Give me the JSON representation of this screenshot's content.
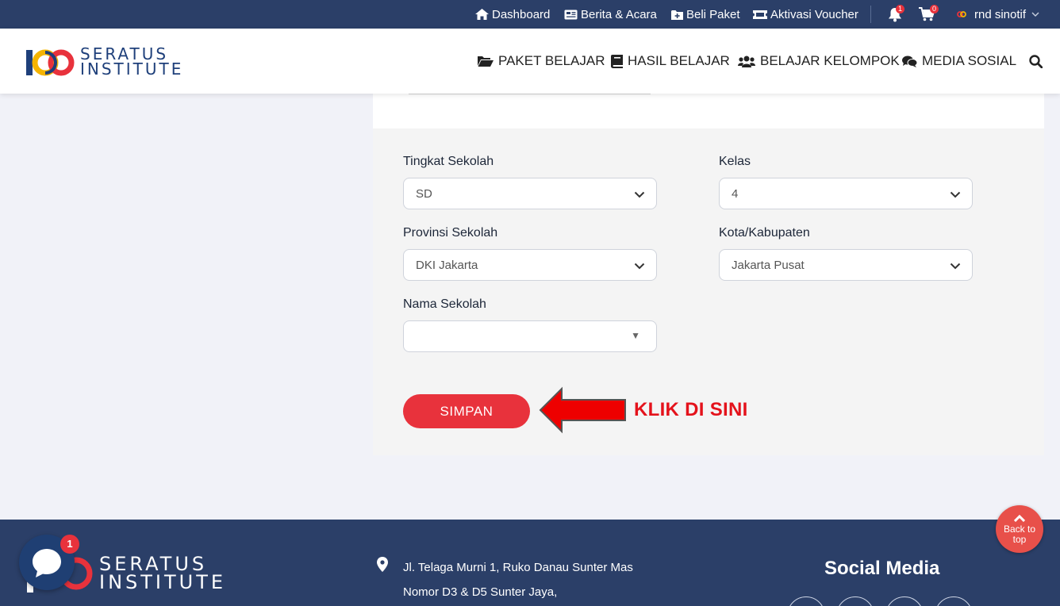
{
  "topbar": {
    "dashboard": "Dashboard",
    "berita": "Berita & Acara",
    "beli_paket": "Beli Paket",
    "aktivasi": "Aktivasi Voucher",
    "notif_count": "1",
    "cart_count": "0",
    "user_name": "rnd sinotif"
  },
  "header": {
    "logo_line1": "SERATUS",
    "logo_line2": "INSTITUTE",
    "nav": {
      "paket": "PAKET BELAJAR",
      "hasil": "HASIL BELAJAR",
      "kelompok": "BELAJAR KELOMPOK",
      "media": "MEDIA SOSIAL"
    }
  },
  "form": {
    "tingkat_label": "Tingkat Sekolah",
    "tingkat_value": "SD",
    "kelas_label": "Kelas",
    "kelas_value": "4",
    "provinsi_label": "Provinsi Sekolah",
    "provinsi_value": "DKI Jakarta",
    "kota_label": "Kota/Kabupaten",
    "kota_value": "Jakarta Pusat",
    "nama_label": "Nama Sekolah",
    "nama_value": "",
    "simpan": "SIMPAN",
    "annotation": "KLIK DI SINI"
  },
  "footer": {
    "logo_line1": "SERATUS",
    "logo_line2": "INSTITUTE",
    "address_line1": "Jl. Telaga Murni 1, Ruko Danau Sunter Mas",
    "address_line2": "Nomor D3 & D5 Sunter Jaya,",
    "social_title": "Social Media",
    "chat_badge": "1",
    "back_to_top_1": "Back to",
    "back_to_top_2": "top"
  },
  "colors": {
    "topbar_bg": "#2b3f68",
    "accent_red": "#e8323c",
    "annotation_red": "#e4121b",
    "brand_blue": "#1e3f7a"
  }
}
